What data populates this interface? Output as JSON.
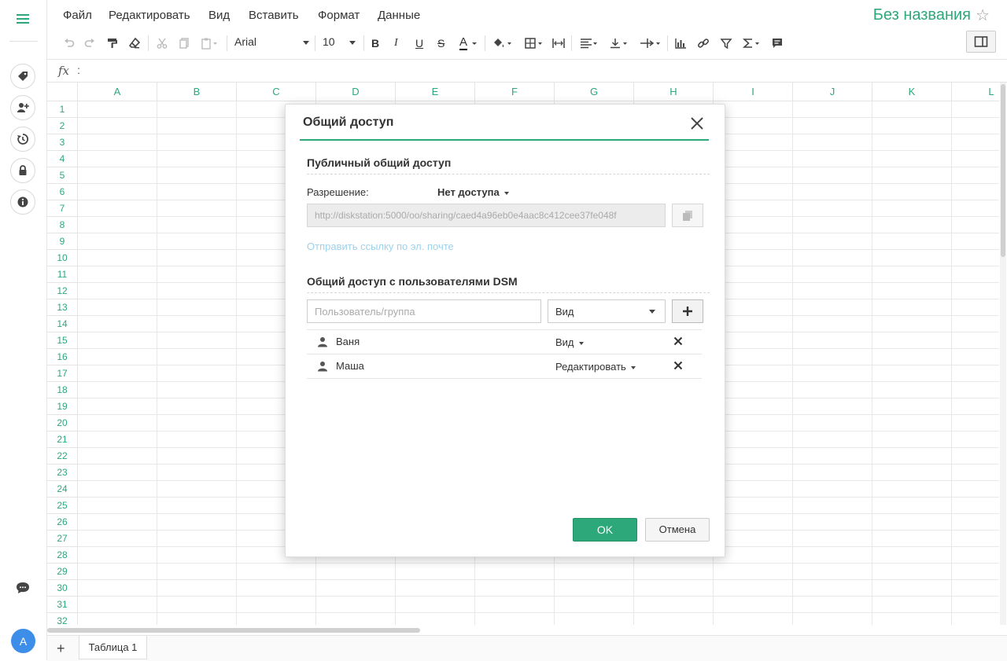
{
  "menubar": {
    "items": [
      "Файл",
      "Редактировать",
      "Вид",
      "Вставить",
      "Формат",
      "Данные"
    ],
    "doc_title": "Без названия",
    "star": "☆"
  },
  "toolbar": {
    "font": "Arial",
    "size": "10",
    "bold": "B",
    "italic": "I",
    "underline": "U",
    "strike": "S",
    "font_color": "A"
  },
  "formula_bar": {
    "fx": "fx",
    "colon": ":"
  },
  "grid": {
    "columns": [
      "A",
      "B",
      "C",
      "D",
      "E",
      "F",
      "G",
      "H",
      "I",
      "J",
      "K",
      "L"
    ],
    "rows": [
      "1",
      "2",
      "3",
      "4",
      "5",
      "6",
      "7",
      "8",
      "9",
      "10",
      "11",
      "12",
      "13",
      "14",
      "15",
      "16",
      "17",
      "18",
      "19",
      "20",
      "21",
      "22",
      "23",
      "24",
      "25",
      "26",
      "27",
      "28",
      "29",
      "30",
      "31",
      "32"
    ]
  },
  "sheets": {
    "add": "+",
    "active": "Таблица 1"
  },
  "user": {
    "avatar_letter": "A"
  },
  "colors": {
    "accent": "#2ca87a",
    "link": "#9dd2ea",
    "avatar": "#3d8ee8"
  },
  "dialog": {
    "title": "Общий доступ",
    "public_section": "Публичный общий доступ",
    "permission_label": "Разрешение:",
    "permission_value": "Нет доступа",
    "share_link": "http://diskstation:5000/oo/sharing/caed4a96eb0e4aac8c412cee37fe048f",
    "email_link": "Отправить ссылку по эл. почте",
    "dsm_section": "Общий доступ с пользователями DSM",
    "user_placeholder": "Пользователь/группа",
    "role_default": "Вид",
    "users": [
      {
        "name": "Ваня",
        "role": "Вид"
      },
      {
        "name": "Маша",
        "role": "Редактировать"
      }
    ],
    "ok": "OK",
    "cancel": "Отмена"
  }
}
